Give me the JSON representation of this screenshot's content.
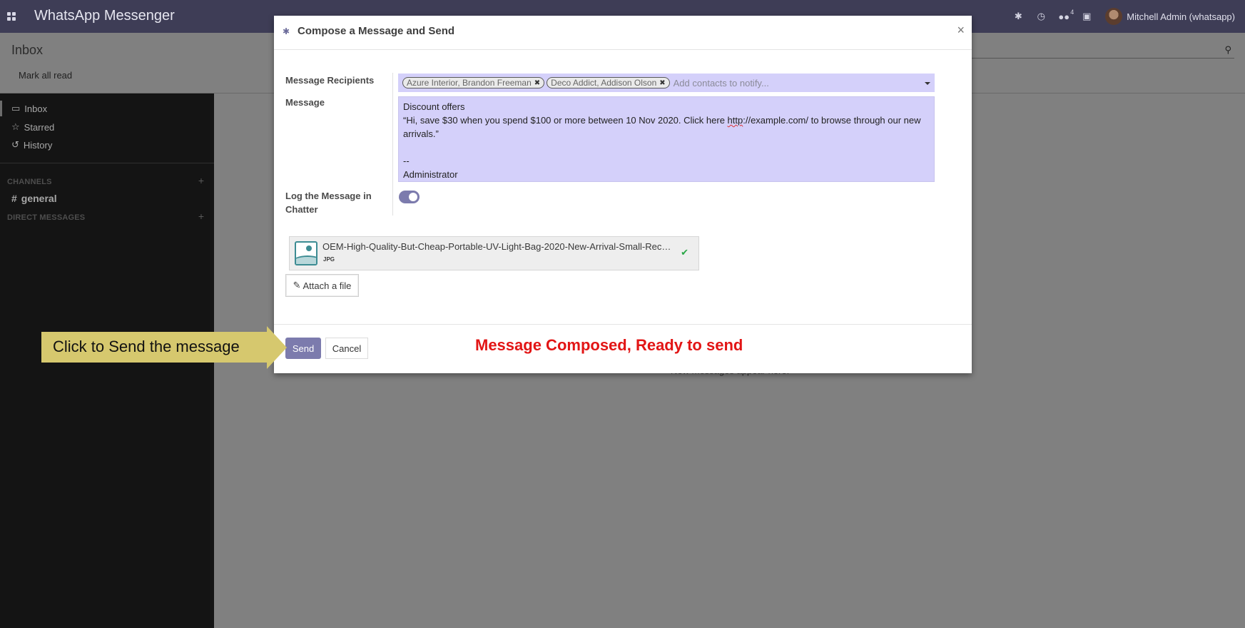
{
  "app": {
    "title": "WhatsApp Messenger",
    "brand_color": "#7c7bad"
  },
  "navbar": {
    "icons": [
      "bug-icon",
      "clock-icon",
      "chat-icon",
      "gift-icon"
    ],
    "chat_badge": "4",
    "user_name": "Mitchell Admin (whatsapp)"
  },
  "control_panel": {
    "title": "Inbox",
    "mark_all_read": "Mark all read"
  },
  "sidebar": {
    "items": [
      {
        "label": "Inbox",
        "icon": "inbox-icon"
      },
      {
        "label": "Starred",
        "icon": "star-icon"
      },
      {
        "label": "History",
        "icon": "history-icon"
      }
    ],
    "channels_header": "CHANNELS",
    "channel": "general",
    "direct_messages_header": "DIRECT MESSAGES"
  },
  "content": {
    "empty_hint": "New messages appear here."
  },
  "modal": {
    "title": "Compose a Message and Send",
    "recipients_label": "Message Recipients",
    "recipients": [
      "Azure Interior, Brandon Freeman",
      "Deco Addict, Addison Olson"
    ],
    "recipients_placeholder": "Add contacts to notify...",
    "message_label": "Message",
    "message_lines": {
      "l1": "Discount offers",
      "l2a": "“Hi, save $30 when you spend $100 or more between 10 Nov 2020. Click here ",
      "l2b": "http",
      "l2c": "://example.com/ to browse through our new",
      "l3": "arrivals.”",
      "l4": "",
      "l5": "--",
      "l6": "Administrator"
    },
    "log_label": "Log the Message in Chatter",
    "log_enabled": true,
    "attachment": {
      "name": "OEM-High-Quality-But-Cheap-Portable-UV-Light-Bag-2020-New-Arrival-Small-Rec…",
      "type": "JPG"
    },
    "attach_button": "Attach a file",
    "send_button": "Send",
    "cancel_button": "Cancel",
    "status_text": "Message Composed, Ready to send"
  },
  "callout": {
    "text": "Click to Send the message"
  }
}
